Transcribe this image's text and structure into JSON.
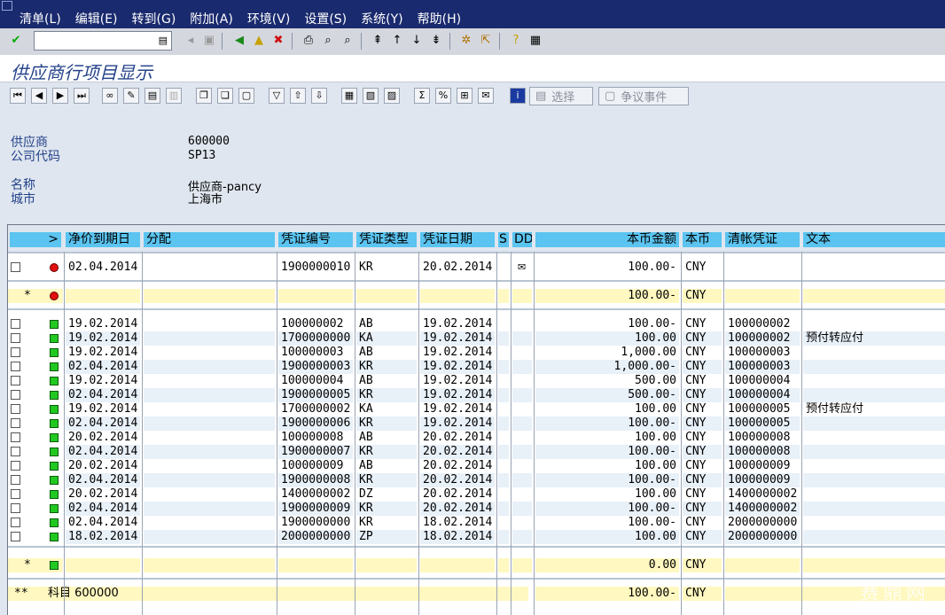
{
  "menu": {
    "items": [
      "清单(L)",
      "编辑(E)",
      "转到(G)",
      "附加(A)",
      "环境(V)",
      "设置(S)",
      "系统(Y)",
      "帮助(H)"
    ]
  },
  "title": "供应商行项目显示",
  "app_toolbar": {
    "select_label": "选择",
    "dispute_label": "争议事件"
  },
  "header": {
    "vendor_label": "供应商",
    "vendor_value": "600000",
    "company_label": "公司代码",
    "company_value": "SP13",
    "name_label": "名称",
    "name_value": "供应商-pancy",
    "city_label": "城市",
    "city_value": "上海市"
  },
  "grid": {
    "columns": {
      "expand": ">",
      "net_due": "净价到期日",
      "assignment": "分配",
      "doc_no": "凭证编号",
      "doc_type": "凭证类型",
      "doc_date": "凭证日期",
      "s": "S",
      "dd": "DD",
      "amount": "本币金额",
      "currency": "本币",
      "clearing": "清帐凭证",
      "text": "文本"
    },
    "open_items": [
      {
        "net_due": "02.04.2014",
        "doc_no": "1900000010",
        "doc_type": "KR",
        "doc_date": "20.02.2014",
        "amount": "100.00-",
        "currency": "CNY",
        "clearing": "",
        "text": ""
      }
    ],
    "open_total": {
      "marker": "*",
      "amount": "100.00-",
      "currency": "CNY"
    },
    "cleared_items": [
      {
        "net_due": "19.02.2014",
        "doc_no": "100000002",
        "doc_type": "AB",
        "doc_date": "19.02.2014",
        "amount": "100.00-",
        "currency": "CNY",
        "clearing": "100000002",
        "text": ""
      },
      {
        "net_due": "19.02.2014",
        "doc_no": "1700000000",
        "doc_type": "KA",
        "doc_date": "19.02.2014",
        "amount": "100.00",
        "currency": "CNY",
        "clearing": "100000002",
        "text": "预付转应付"
      },
      {
        "net_due": "19.02.2014",
        "doc_no": "100000003",
        "doc_type": "AB",
        "doc_date": "19.02.2014",
        "amount": "1,000.00",
        "currency": "CNY",
        "clearing": "100000003",
        "text": ""
      },
      {
        "net_due": "02.04.2014",
        "doc_no": "1900000003",
        "doc_type": "KR",
        "doc_date": "19.02.2014",
        "amount": "1,000.00-",
        "currency": "CNY",
        "clearing": "100000003",
        "text": ""
      },
      {
        "net_due": "19.02.2014",
        "doc_no": "100000004",
        "doc_type": "AB",
        "doc_date": "19.02.2014",
        "amount": "500.00",
        "currency": "CNY",
        "clearing": "100000004",
        "text": ""
      },
      {
        "net_due": "02.04.2014",
        "doc_no": "1900000005",
        "doc_type": "KR",
        "doc_date": "19.02.2014",
        "amount": "500.00-",
        "currency": "CNY",
        "clearing": "100000004",
        "text": ""
      },
      {
        "net_due": "19.02.2014",
        "doc_no": "1700000002",
        "doc_type": "KA",
        "doc_date": "19.02.2014",
        "amount": "100.00",
        "currency": "CNY",
        "clearing": "100000005",
        "text": "预付转应付"
      },
      {
        "net_due": "02.04.2014",
        "doc_no": "1900000006",
        "doc_type": "KR",
        "doc_date": "19.02.2014",
        "amount": "100.00-",
        "currency": "CNY",
        "clearing": "100000005",
        "text": ""
      },
      {
        "net_due": "20.02.2014",
        "doc_no": "100000008",
        "doc_type": "AB",
        "doc_date": "20.02.2014",
        "amount": "100.00",
        "currency": "CNY",
        "clearing": "100000008",
        "text": ""
      },
      {
        "net_due": "02.04.2014",
        "doc_no": "1900000007",
        "doc_type": "KR",
        "doc_date": "20.02.2014",
        "amount": "100.00-",
        "currency": "CNY",
        "clearing": "100000008",
        "text": ""
      },
      {
        "net_due": "20.02.2014",
        "doc_no": "100000009",
        "doc_type": "AB",
        "doc_date": "20.02.2014",
        "amount": "100.00",
        "currency": "CNY",
        "clearing": "100000009",
        "text": ""
      },
      {
        "net_due": "02.04.2014",
        "doc_no": "1900000008",
        "doc_type": "KR",
        "doc_date": "20.02.2014",
        "amount": "100.00-",
        "currency": "CNY",
        "clearing": "100000009",
        "text": ""
      },
      {
        "net_due": "20.02.2014",
        "doc_no": "1400000002",
        "doc_type": "DZ",
        "doc_date": "20.02.2014",
        "amount": "100.00",
        "currency": "CNY",
        "clearing": "1400000002",
        "text": ""
      },
      {
        "net_due": "02.04.2014",
        "doc_no": "1900000009",
        "doc_type": "KR",
        "doc_date": "20.02.2014",
        "amount": "100.00-",
        "currency": "CNY",
        "clearing": "1400000002",
        "text": ""
      },
      {
        "net_due": "02.04.2014",
        "doc_no": "1900000000",
        "doc_type": "KR",
        "doc_date": "18.02.2014",
        "amount": "100.00-",
        "currency": "CNY",
        "clearing": "2000000000",
        "text": ""
      },
      {
        "net_due": "18.02.2014",
        "doc_no": "2000000000",
        "doc_type": "ZP",
        "doc_date": "18.02.2014",
        "amount": "100.00",
        "currency": "CNY",
        "clearing": "2000000000",
        "text": ""
      }
    ],
    "cleared_total": {
      "marker": "*",
      "amount": "0.00",
      "currency": "CNY"
    },
    "account_total": {
      "marker": "**",
      "label": "科目 600000",
      "amount": "100.00-",
      "currency": "CNY"
    }
  },
  "watermark": "赛鼎网",
  "colors": {
    "menubar": "#1a2a6e",
    "header_cell": "#5bc4f0",
    "total_row": "#fff8c0",
    "row_alt": "#e8f0f8",
    "title": "#24428a"
  }
}
